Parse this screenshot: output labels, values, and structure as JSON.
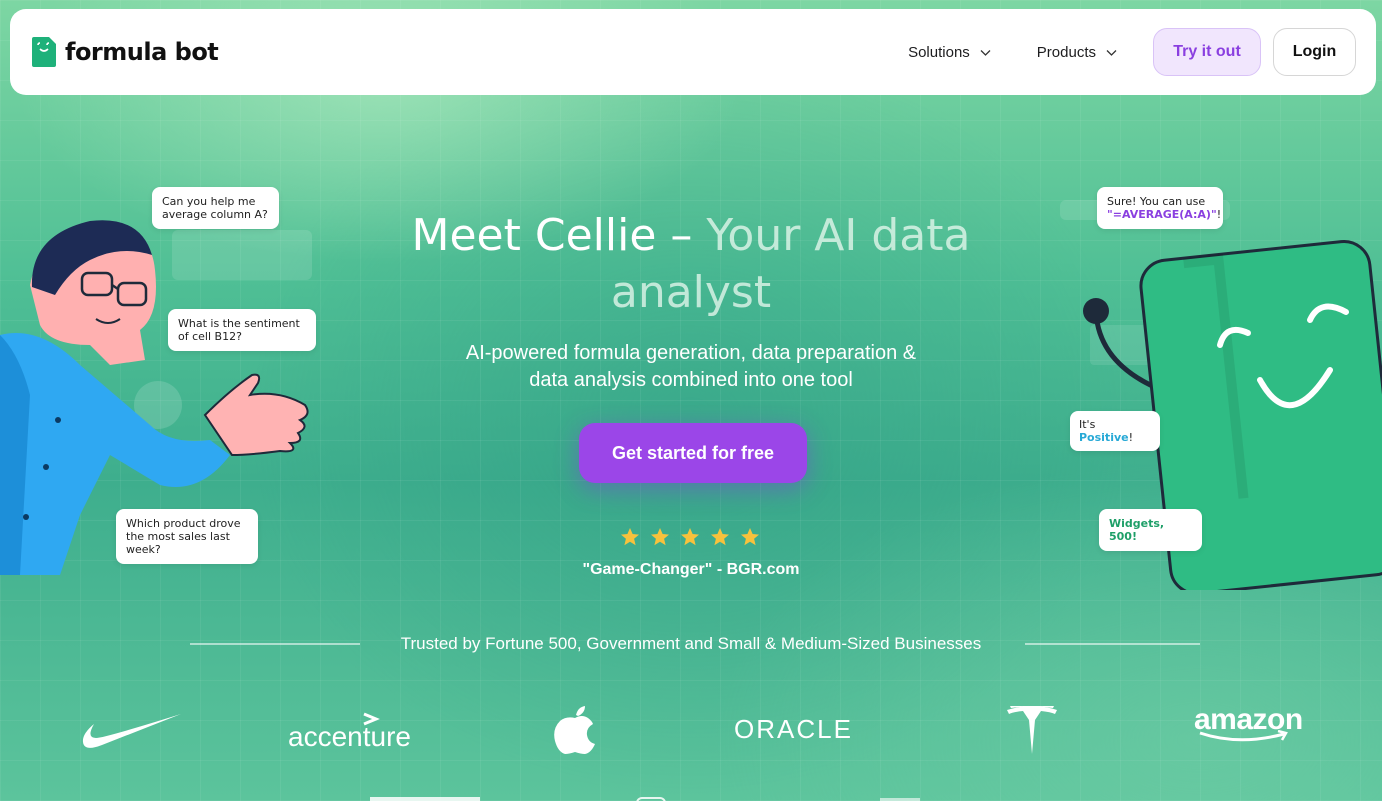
{
  "brand": {
    "name": "formula bot"
  },
  "nav": {
    "items": [
      {
        "label": "Solutions"
      },
      {
        "label": "Products"
      }
    ],
    "try_label": "Try it out",
    "login_label": "Login"
  },
  "hero": {
    "title_line1_a": "Meet Cellie – ",
    "title_line1_b": "Your AI data",
    "title_line2": "analyst",
    "subtitle_line1": "AI-powered formula generation, data preparation &",
    "subtitle_line2": "data analysis combined into one tool",
    "cta_label": "Get started for free",
    "rating_stars": 5,
    "quote": "\"Game-Changer\" - BGR.com"
  },
  "bubbles_left": {
    "b1": "Can you help me average column A?",
    "b2": "What is the sentiment of cell B12?",
    "b3": "Which product drove the most sales last week?"
  },
  "bubbles_right": {
    "r1_prefix": "Sure! You can use",
    "r1_formula": "\"=AVERAGE(A:A)\"",
    "r1_suffix": "!",
    "r2_prefix": "It's ",
    "r2_highlight": "Positive",
    "r2_suffix": "!",
    "r3": "Widgets, 500!"
  },
  "trusted": {
    "label": "Trusted by Fortune 500, Government and Small & Medium-Sized Businesses",
    "logos": [
      "nike-logo",
      "accenture",
      "apple-logo",
      "ORACLE",
      "tesla-logo",
      "amazon"
    ]
  },
  "colors": {
    "accent_purple": "#9b46e8",
    "brand_green": "#1eb17a",
    "star_yellow": "#f7c23c"
  }
}
